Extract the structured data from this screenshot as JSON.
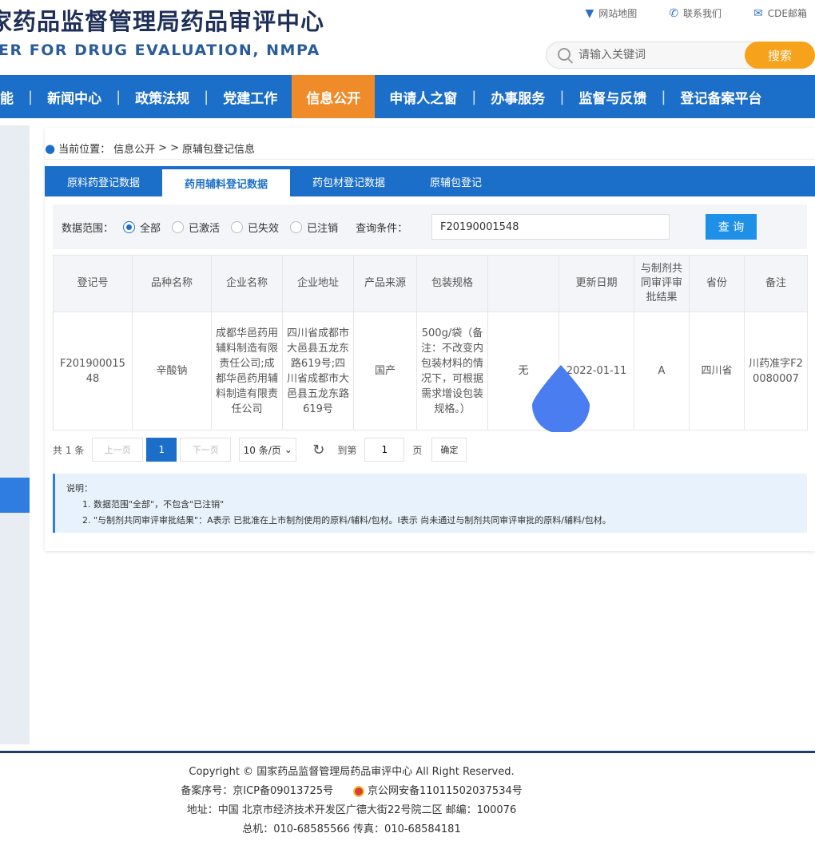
{
  "header": {
    "title_cn": "家药品监督管理局药品审评中心",
    "title_en": "ER FOR DRUG EVALUATION, NMPA",
    "links": [
      "网站地图",
      "联系我们",
      "CDE邮箱"
    ],
    "search_placeholder": "请输入关键词",
    "search_button": "搜索"
  },
  "nav": {
    "items": [
      "能",
      "新闻中心",
      "政策法规",
      "党建工作",
      "信息公开",
      "申请人之窗",
      "办事服务",
      "监督与反馈",
      "登记备案平台"
    ],
    "active_index": 4
  },
  "breadcrumb": {
    "label": "当前位置：",
    "path": "信息公开",
    "sep": "> >",
    "current": "原辅包登记信息"
  },
  "tabs": [
    "原料药登记数据",
    "药用辅料登记数据",
    "药包材登记数据",
    "原辅包登记"
  ],
  "filter": {
    "label": "数据范围：",
    "options": [
      "全部",
      "已激活",
      "已失效",
      "已注销"
    ],
    "selected": "全部",
    "condition_label": "查询条件：",
    "condition_value": "F20190001548",
    "query_button": "查 询"
  },
  "table": {
    "headers": [
      "登记号",
      "品种名称",
      "企业名称",
      "企业地址",
      "产品来源",
      "包装规格",
      "",
      "更新日期",
      "与制剂共同审评审批结果",
      "省份",
      "备注"
    ],
    "rows": [
      [
        "F20190001548",
        "辛酸钠",
        "成都华邑药用辅料制造有限责任公司;成都华邑药用辅料制造有限责任公司",
        "四川省成都市大邑县五龙东路619号;四川省成都市大邑县五龙东路619号",
        "国产",
        "500g/袋（备注：不改变内包装材料的情况下，可根据需求增设包装规格。）",
        "无",
        "2022-01-11",
        "A",
        "四川省",
        "川药准字F20080007"
      ]
    ]
  },
  "pager": {
    "total": "共 1 条",
    "prev": "上一页",
    "page": "1",
    "next": "下一页",
    "size": "10 条/页",
    "goto_label": "到第",
    "goto_value": "1",
    "page_unit": "页",
    "confirm": "确定"
  },
  "notes": {
    "title": "说明：",
    "line1": "1. 数据范围\"全部\"，不包含\"已注销\"",
    "line2": "2. \"与制剂共同审评审批结果\"：A表示 已批准在上市制剂使用的原料/辅料/包材。I表示 尚未通过与制剂共同审评审批的原料/辅料/包材。"
  },
  "footer": {
    "copyright": "Copyright © 国家药品监督管理局药品审评中心   All Right Reserved.",
    "icp": "备案序号：京ICP备09013725号",
    "police": "京公网安备11011502037534号",
    "address": "地址：中国 北京市经济技术开发区广德大街22号院二区      邮编：100076",
    "phone": "总机：010-68585566      传真：010-68584181"
  },
  "colors": {
    "nav_blue": "#1c6fc9",
    "active_orange": "#f08b2a",
    "search_orange": "#f7a21b",
    "drop_blue": "#4a7ef0"
  }
}
